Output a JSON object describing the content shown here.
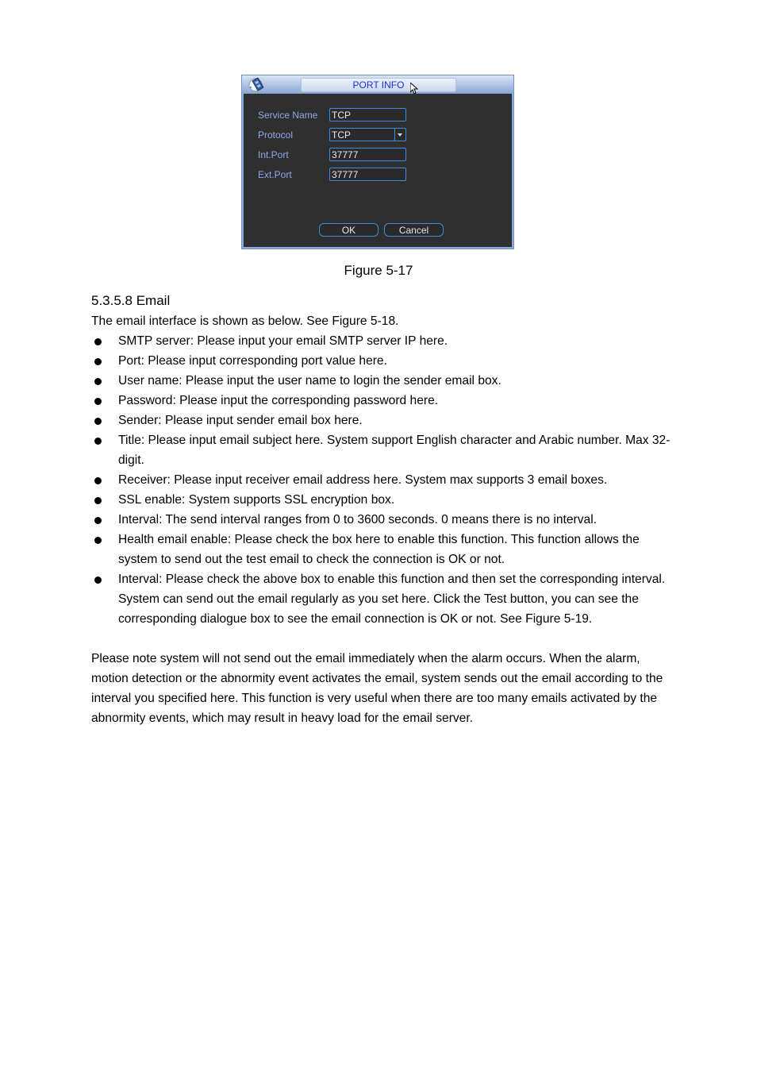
{
  "dialog": {
    "title": "PORT INFO",
    "fields": [
      {
        "label": "Service Name",
        "value": "TCP",
        "type": "text"
      },
      {
        "label": "Protocol",
        "value": "TCP",
        "type": "select"
      },
      {
        "label": "Int.Port",
        "value": "37777",
        "type": "text"
      },
      {
        "label": "Ext.Port",
        "value": "37777",
        "type": "text"
      }
    ],
    "ok_label": "OK",
    "cancel_label": "Cancel"
  },
  "figure_caption": "Figure 5-17",
  "section_heading": "5.3.5.8  Email",
  "intro": "The email interface is shown as below. See Figure 5-18.",
  "bullets": [
    "SMTP server: Please input your email SMTP server IP here.",
    "Port: Please input corresponding port value here.",
    "User name:  Please input the user name to login the sender email box.",
    "Password: Please input the corresponding password here.",
    "Sender: Please input sender email box here.",
    "Title: Please input email subject here. System support English character and Arabic number. Max 32-digit.",
    "Receiver: Please input receiver email address here. System max supports 3 email boxes.",
    "SSL enable: System supports SSL encryption box.",
    "Interval: The send interval ranges from 0 to 3600 seconds. 0 means there is no interval.",
    "Health email enable: Please check the box here to enable this function. This function allows the system to send out the test email to check the connection is OK or not.",
    "Interval: Please check the above box to enable this function and then set the corresponding interval. System can send out the email regularly as you set here. Click the Test button, you can see the corresponding dialogue box to see the email connection is OK or not.  See Figure 5-19."
  ],
  "note": "Please note system will not send out the email immediately when the alarm occurs. When the alarm, motion detection or the abnormity event activates the email, system sends out the email according to the interval you specified here. This function is very useful when there are too many emails activated by the abnormity events, which may result in heavy load for the email server."
}
